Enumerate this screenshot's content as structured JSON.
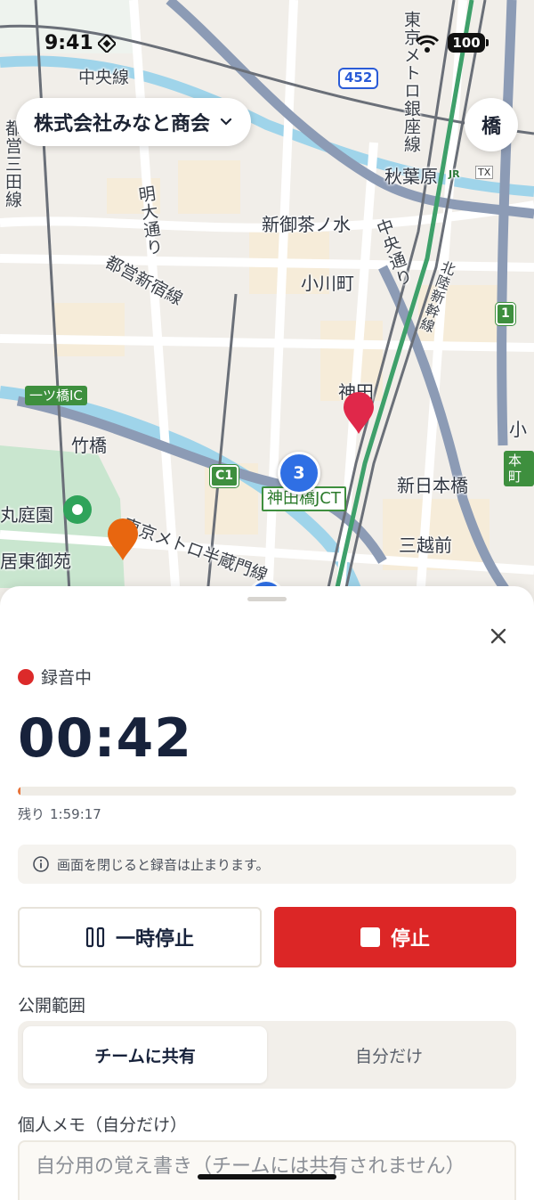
{
  "status_bar": {
    "time": "9:41",
    "battery": "100"
  },
  "map": {
    "company_selector": "株式会社みなと商会",
    "corner_button": "橋",
    "cluster_count": "3",
    "route_452": "452",
    "labels": {
      "chuo_line": "中央線",
      "akihabara": "秋葉原",
      "shin_ochanomizu": "新御茶ノ水",
      "ogawamachi": "小川町",
      "kanda": "神田",
      "shin_nihombashi": "新日本橋",
      "mitsukoshimae": "三越前",
      "takebashi": "竹橋",
      "kudan": "丸庭園",
      "kokyo": "居東御苑",
      "toei_shinjuku": "都営新宿線",
      "toei_mita": "都営三田線",
      "meidai": "明大通り",
      "hanzomon": "東京メトロ半蔵門線",
      "ginza_line": "東京メトロ銀座線",
      "chuo_dori": "中央通り",
      "hokuriku": "北陸新幹線",
      "ko": "小",
      "hitotsubashi_ic": "一ツ橋IC",
      "kandabashi_jct": "神田橋JCT",
      "c1": "C1",
      "route1": "1",
      "honcho": "本町",
      "jr": "JR",
      "tx": "TX"
    }
  },
  "sheet": {
    "close_label": "×",
    "recording_status": "録音中",
    "timer": "00:42",
    "progress_fraction": 0.006,
    "remaining_label": "残り",
    "remaining_time": "1:59:17",
    "notice": "画面を閉じると録音は止まります。",
    "pause_button": "一時停止",
    "stop_button": "停止",
    "visibility_label": "公開範囲",
    "visibility_options": [
      "チームに共有",
      "自分だけ"
    ],
    "visibility_selected": "チームに共有",
    "memo_label": "個人メモ（自分だけ）",
    "memo_placeholder": "自分用の覚え書き（チームには共有されません）"
  },
  "colors": {
    "record_red": "#dc2626",
    "progress_orange": "#e8733a",
    "cluster_blue": "#2f6fe4",
    "pin_red": "#e0284a",
    "pin_orange": "#e8660f"
  }
}
